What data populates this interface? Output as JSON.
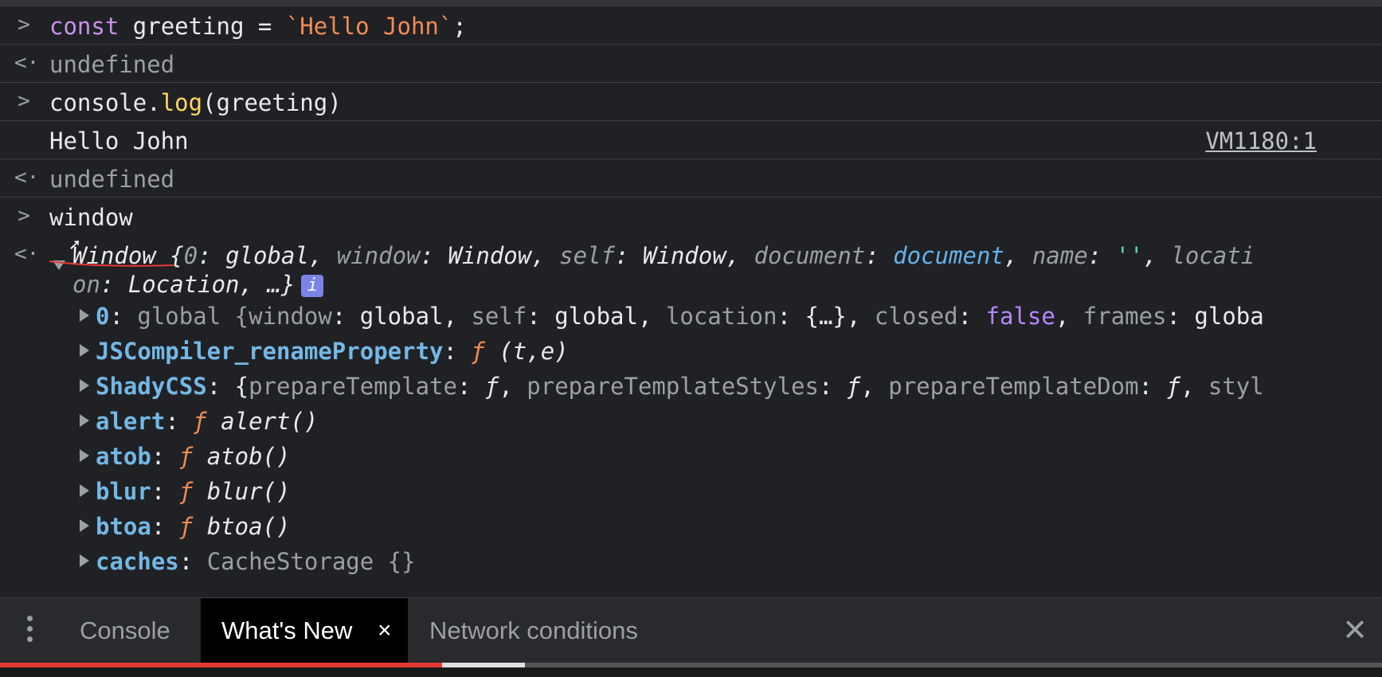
{
  "console": {
    "line1": {
      "prompt": ">",
      "kw": "const",
      "rest": " greeting = ",
      "str": "`Hello John`",
      "end": ";"
    },
    "line2": {
      "prompt": "<·",
      "value": "undefined"
    },
    "line3": {
      "prompt": ">",
      "obj": "console.",
      "fn": "log",
      "args": "(greeting)"
    },
    "line4": {
      "output": "Hello John",
      "source": "VM1180:1"
    },
    "line5": {
      "prompt": "<·",
      "value": "undefined"
    },
    "line6": {
      "prompt": ">",
      "value": "window"
    },
    "window_summary": {
      "prompt": "<·",
      "a": "Window {",
      "b": "0",
      "c": ": global, ",
      "d": "window",
      "e": ": Window, ",
      "f": "self",
      "g": ": Window, ",
      "h": "document",
      "i": ": ",
      "j": "document",
      "k": ", ",
      "l": "name",
      "m": ": ",
      "n": "''",
      "o": ", ",
      "p": "locati",
      "q": "on",
      "r": ": Location, …}",
      "info": "i"
    },
    "props": [
      {
        "key": "0",
        "parts": [
          ": ",
          "global {",
          "window",
          ": global, ",
          "self",
          ": global, ",
          "location",
          ": {…}, ",
          "closed",
          ": ",
          "false",
          ", ",
          "frames",
          ": globa"
        ]
      },
      {
        "key": "JSCompiler_renameProperty",
        "sep": ": ",
        "f": "ƒ",
        "sig": " (t,e)"
      },
      {
        "key": "ShadyCSS",
        "rest_a": ": {",
        "k1": "prepareTemplate",
        "v1": ": ",
        "f1": "ƒ",
        "c1": ", ",
        "k2": "prepareTemplateStyles",
        "v2": ": ",
        "f2": "ƒ",
        "c2": ", ",
        "k3": "prepareTemplateDom",
        "v3": ": ",
        "f3": "ƒ",
        "c3": ", ",
        "k4": "styl"
      },
      {
        "key": "alert",
        "sep": ": ",
        "f": "ƒ",
        "sig": " alert()"
      },
      {
        "key": "atob",
        "sep": ": ",
        "f": "ƒ",
        "sig": " atob()"
      },
      {
        "key": "blur",
        "sep": ": ",
        "f": "ƒ",
        "sig": " blur()"
      },
      {
        "key": "btoa",
        "sep": ": ",
        "f": "ƒ",
        "sig": " btoa()"
      },
      {
        "key": "caches",
        "sep": ": ",
        "sig": "CacheStorage {}"
      }
    ]
  },
  "drawer": {
    "tabs": {
      "console": "Console",
      "whats_new": "What's New",
      "network": "Network conditions"
    },
    "close_tab": "×",
    "close_drawer": "✕"
  },
  "video": {
    "played_fraction": 0.32,
    "buffered_fraction": 0.38
  },
  "colors": {
    "background": "#202124",
    "string": "#f28b54",
    "keyword": "#c792ea",
    "prop_key": "#73b8e6",
    "boolean": "#b388ff"
  }
}
